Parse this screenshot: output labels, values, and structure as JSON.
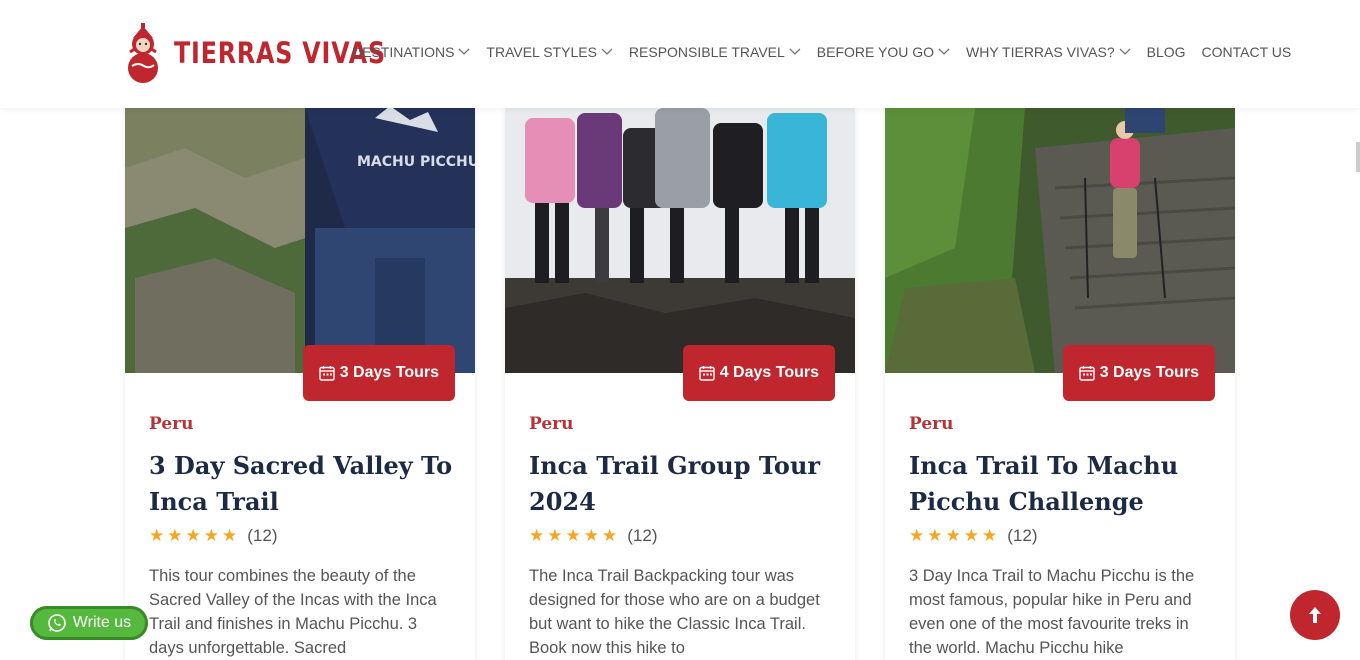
{
  "brand": {
    "name": "TIERRAS VIVAS",
    "accent": "#c0262d"
  },
  "nav": [
    {
      "label": "DESTINATIONS",
      "dropdown": true
    },
    {
      "label": "TRAVEL STYLES",
      "dropdown": true
    },
    {
      "label": "RESPONSIBLE TRAVEL",
      "dropdown": true
    },
    {
      "label": "BEFORE YOU GO",
      "dropdown": true
    },
    {
      "label": "WHY TIERRAS VIVAS?",
      "dropdown": true
    },
    {
      "label": "BLOG",
      "dropdown": false
    },
    {
      "label": "CONTACT US",
      "dropdown": false
    }
  ],
  "cards": [
    {
      "badge": "3 Days Tours",
      "country": "Peru",
      "title": "3 Day Sacred Valley To Inca Trail",
      "rating": 5,
      "reviews": "(12)",
      "description": "This tour combines the beauty of the Sacred Valley of the Incas with the Inca Trail and finishes in Machu Picchu. 3 days unforgettable. Sacred",
      "image_text": "MACHU PICCHU"
    },
    {
      "badge": "4 Days Tours",
      "country": "Peru",
      "title": "Inca Trail Group Tour 2024",
      "rating": 5,
      "reviews": "(12)",
      "description": "The Inca Trail Backpacking tour was designed for those who are on a budget but want to hike the Classic Inca Trail. Book now this hike to"
    },
    {
      "badge": "3 Days Tours",
      "country": "Peru",
      "title": "Inca Trail To Machu Picchu Challenge",
      "rating": 5,
      "reviews": "(12)",
      "description": "3 Day Inca Trail to Machu Picchu is the most famous, popular hike in Peru and even one of the most favourite treks in the world. Machu Picchu hike"
    }
  ],
  "floating": {
    "write_us": "Write us",
    "whatsapp_color": "#55b93d"
  },
  "icons": {
    "nav_dropdown": "chevron-down-icon",
    "badge": "calendar-icon",
    "rating": "star-icon",
    "write_us": "whatsapp-icon",
    "back_to_top": "arrow-up-icon"
  }
}
